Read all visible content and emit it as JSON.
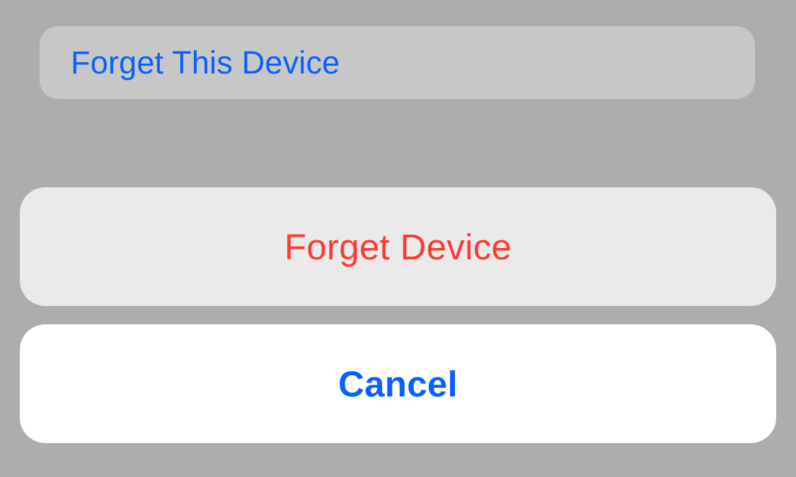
{
  "list_item": {
    "label": "Forget This Device"
  },
  "action_sheet": {
    "destructive_label": "Forget Device",
    "cancel_label": "Cancel"
  },
  "colors": {
    "background": "#adadaf",
    "list_item_bg": "#c8c7c7",
    "action_button_bg": "#ebeaea",
    "cancel_button_bg": "#ffffff",
    "ios_blue": "#0a60ff",
    "ios_red": "#ff3a31"
  }
}
